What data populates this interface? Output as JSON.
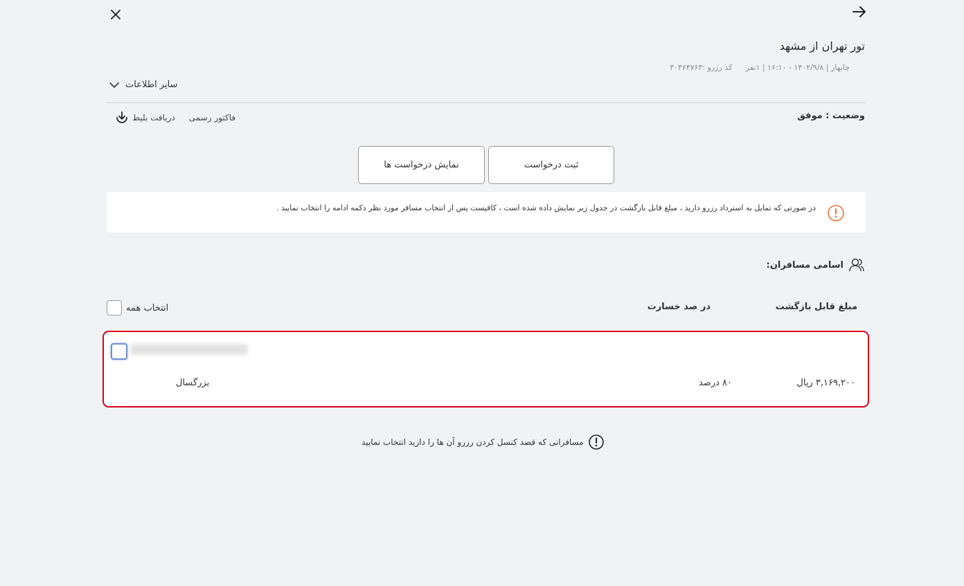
{
  "header": {
    "title": "تور تهران از مشهد",
    "subtitle": "چابهار | ۱۴۰۲/۹/۸ - ۱۶:۱۰ | ۱نفر",
    "reservation_code": "کد رزرو :۳۰۳۶۴۷۶۳"
  },
  "more_info": {
    "label": "سایر اطلاعات"
  },
  "status": {
    "label": "وضعیت : موفق"
  },
  "doc_links": {
    "invoice": "فاکتور رسمی",
    "ticket": "دریافت بلیط"
  },
  "actions": {
    "register": "ثبت درخواست",
    "show": "نمایش درخواست ها"
  },
  "alert": {
    "text": "در صورتی که تمایل به استرداد رزرو دارید ، مبلغ قابل بازگشت در جدول زیر نمایش داده شده است ، کافیست پس از انتخاب مسافر مورد نظر دکمه ادامه را انتخاب نمایید ."
  },
  "passengers": {
    "title": "اسامی مسافران:",
    "columns": {
      "refund": "مبلغ قابل بازگشت",
      "loss": "در صد خسارت"
    },
    "select_all": "انتخاب همه",
    "rows": [
      {
        "type": "بزرگسال",
        "loss": "۸۰ درصد",
        "refund": "۳,۱۶۹,۲۰۰ ریال"
      }
    ]
  },
  "footer": {
    "note": "مسافرانی که قصد کنسل کردن رزرو آن ها را دارید انتخاب نمایید"
  },
  "colors": {
    "accent_red": "#d9001b",
    "alert_orange": "#e8743b",
    "background": "#f1f2f4"
  }
}
